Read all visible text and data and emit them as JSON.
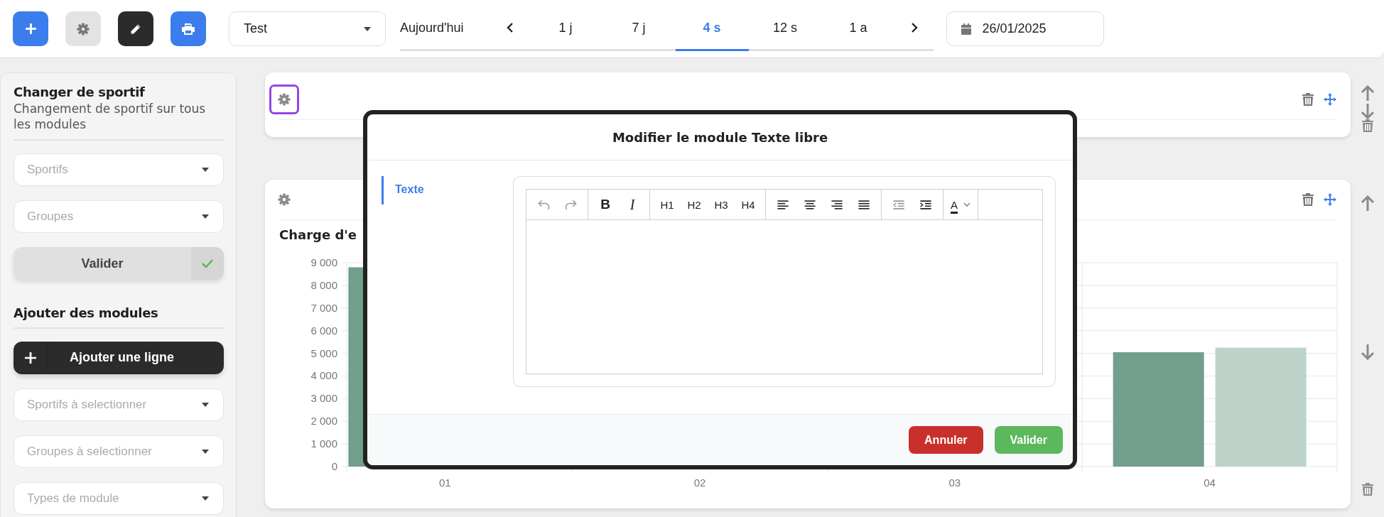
{
  "top_bar": {
    "buttons": [
      {
        "kind": "add"
      },
      {
        "kind": "settings"
      },
      {
        "kind": "edit"
      },
      {
        "kind": "print"
      }
    ],
    "profile_select": {
      "value": "Test"
    },
    "period": {
      "today": "Aujourd'hui",
      "tabs": [
        {
          "label": "1 j",
          "selected": false
        },
        {
          "label": "7 j",
          "selected": false
        },
        {
          "label": "4 s",
          "selected": true
        },
        {
          "label": "12 s",
          "selected": false
        },
        {
          "label": "1 a",
          "selected": false
        }
      ]
    },
    "date_field": {
      "value": "26/01/2025"
    }
  },
  "sidebar": {
    "athlete_section": {
      "title": "Changer de sportif",
      "subtitle": "Changement de sportif sur tous les modules",
      "selects": [
        {
          "placeholder": "Sportifs"
        },
        {
          "placeholder": "Groupes"
        }
      ],
      "validate_button": "Valider"
    },
    "modules_section": {
      "title": "Ajouter des modules",
      "add_row_button": "Ajouter une ligne",
      "selects": [
        {
          "placeholder": "Sportifs à selectionner"
        },
        {
          "placeholder": "Groupes à selectionner"
        },
        {
          "placeholder": "Types de module"
        }
      ]
    }
  },
  "modules": [
    {
      "kind": "empty",
      "gear_highlighted": true
    },
    {
      "kind": "chart",
      "gear_highlighted": false,
      "title": "Charge d'e",
      "chart_data": {
        "type": "bar",
        "categories": [
          "01",
          "02",
          "03",
          "04"
        ],
        "series": [
          {
            "color": "#729e8c",
            "values": [
              8800,
              null,
              null,
              5050
            ]
          },
          {
            "color": "#bdd3c9",
            "values": [
              null,
              null,
              null,
              5250
            ]
          }
        ],
        "ylim": [
          0,
          9000
        ],
        "grid": true,
        "yticks": [
          {
            "value": 0,
            "label": "0"
          },
          {
            "value": 1000,
            "label": "1 000"
          },
          {
            "value": 2000,
            "label": "2 000"
          },
          {
            "value": 3000,
            "label": "3 000"
          },
          {
            "value": 4000,
            "label": "4 000"
          },
          {
            "value": 5000,
            "label": "5 000"
          },
          {
            "value": 6000,
            "label": "6 000"
          },
          {
            "value": 7000,
            "label": "7 000"
          },
          {
            "value": 8000,
            "label": "8 000"
          },
          {
            "value": 9000,
            "label": "9 000"
          }
        ]
      }
    }
  ],
  "modal": {
    "title": "Modifier le module Texte libre",
    "tabs": [
      {
        "label": "Texte",
        "selected": true
      }
    ],
    "editor": {
      "toolbar": [
        {
          "items": [
            {
              "kind": "undo",
              "disabled": true
            },
            {
              "kind": "redo",
              "disabled": true
            }
          ]
        },
        {
          "items": [
            {
              "kind": "bold",
              "label": "B",
              "disabled": false
            },
            {
              "kind": "italic",
              "label": "I",
              "disabled": false
            }
          ]
        },
        {
          "items": [
            {
              "kind": "heading",
              "label": "H1",
              "disabled": false
            },
            {
              "kind": "heading",
              "label": "H2",
              "disabled": false
            },
            {
              "kind": "heading",
              "label": "H3",
              "disabled": false
            },
            {
              "kind": "heading",
              "label": "H4",
              "disabled": false
            }
          ]
        },
        {
          "items": [
            {
              "kind": "align-left",
              "disabled": false
            },
            {
              "kind": "align-center",
              "disabled": false
            },
            {
              "kind": "align-right",
              "disabled": false
            },
            {
              "kind": "align-justify",
              "disabled": false
            }
          ]
        },
        {
          "items": [
            {
              "kind": "outdent",
              "disabled": true
            },
            {
              "kind": "indent",
              "disabled": false
            }
          ]
        },
        {
          "items": [
            {
              "kind": "text-color",
              "label": "A",
              "disabled": false
            }
          ]
        }
      ]
    },
    "buttons": [
      {
        "kind": "cancel",
        "label": "Annuler"
      },
      {
        "kind": "confirm",
        "label": "Valider"
      }
    ]
  }
}
